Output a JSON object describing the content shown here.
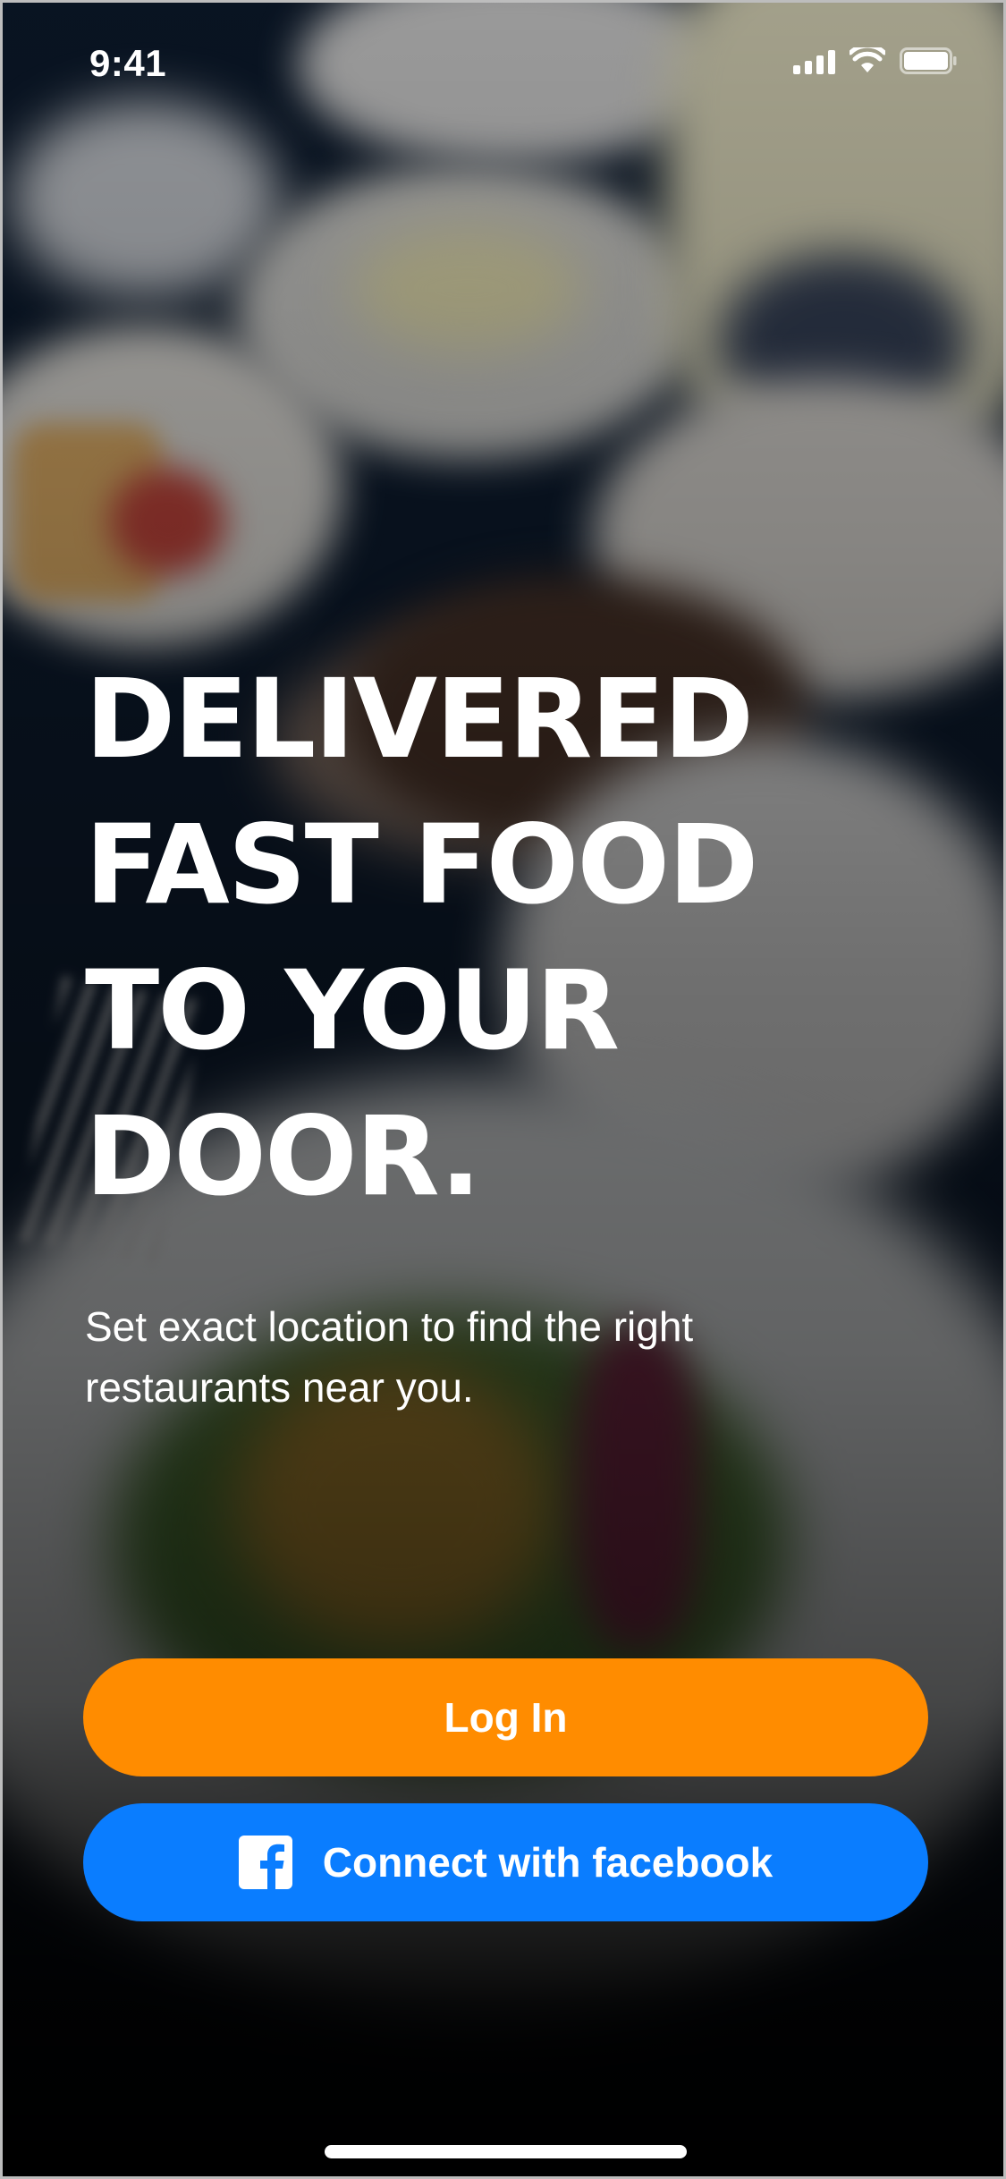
{
  "status_bar": {
    "time": "9:41"
  },
  "hero": {
    "headline_lines": [
      "DELIVERED",
      "FAST FOOD",
      "TO YOUR",
      "DOOR."
    ],
    "subtitle": "Set exact location to find the right restaurants near you."
  },
  "actions": {
    "login_label": "Log In",
    "facebook_label": "Connect with facebook"
  },
  "colors": {
    "login_button": "#ff8c00",
    "facebook_button": "#0a7dff",
    "text": "#ffffff"
  },
  "icons": {
    "signal": "cellular-signal-icon",
    "wifi": "wifi-icon",
    "battery": "battery-icon",
    "facebook": "facebook-icon"
  }
}
